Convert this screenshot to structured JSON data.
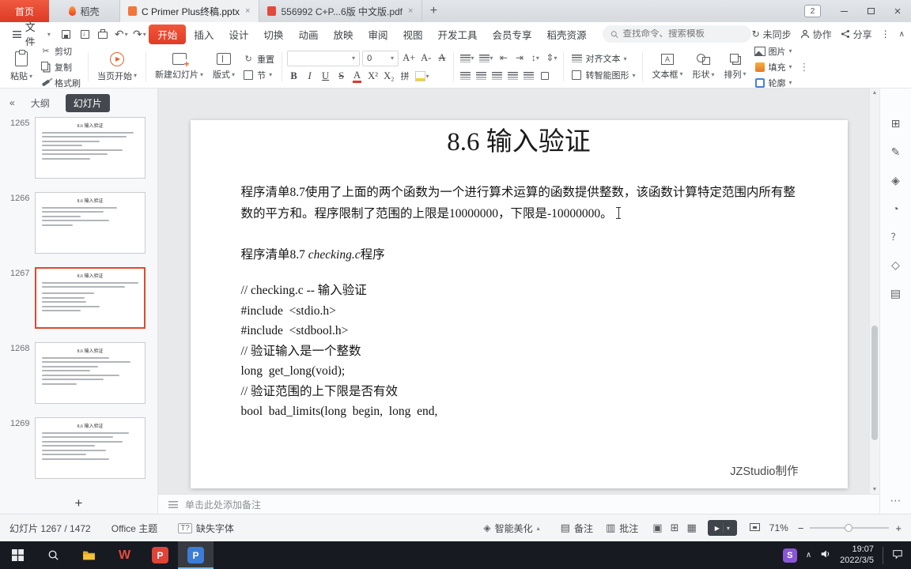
{
  "colors": {
    "accent": "#e5412e",
    "selection_border": "#e0492e",
    "taskbar_active_underline": "#76b9ed"
  },
  "titlebar": {
    "home": "首页",
    "docer": "稻壳",
    "badge": "2",
    "tabs": [
      {
        "label": "C Primer Plus终稿.pptx"
      },
      {
        "label": "556992 C+P...6版 中文版.pdf"
      }
    ]
  },
  "menubar": {
    "file": "文件",
    "tabs": [
      "开始",
      "插入",
      "设计",
      "切换",
      "动画",
      "放映",
      "审阅",
      "视图",
      "开发工具",
      "会员专享",
      "稻壳资源"
    ],
    "active_tab": "开始",
    "search_placeholder": "查找命令、搜索模板",
    "sync": "未同步",
    "collaborate": "协作",
    "share": "分享"
  },
  "ribbon": {
    "paste": "粘贴",
    "cut": "剪切",
    "copy": "复制",
    "painter": "格式刷",
    "play_current": "当页开始",
    "new_slide": "新建幻灯片",
    "layout": "版式",
    "reset": "重置",
    "section": "节",
    "font_name": "",
    "font_size": "0",
    "grow_font": "A+",
    "shrink_font": "A-",
    "clear_format": "A",
    "bold": "B",
    "italic": "I",
    "underline": "U",
    "strike": "S",
    "font_color": "A",
    "superscript": "X²",
    "subscript": "X₂",
    "pinyin": "拼",
    "align_text": "对齐文本",
    "smart_graphic": "转智能图形",
    "textbox": "文本框",
    "shapes": "形状",
    "arrange": "排列",
    "picture": "图片",
    "fill": "填充",
    "outline": "轮廓"
  },
  "sidebar": {
    "outline_tab": "大纲",
    "slides_tab": "幻灯片",
    "slides": [
      {
        "num": "1265",
        "title": "8.6 输入验证"
      },
      {
        "num": "1266",
        "title": "8.6 输入验证"
      },
      {
        "num": "1267",
        "title": "8.6 输入验证"
      },
      {
        "num": "1268",
        "title": "8.6 输入验证"
      },
      {
        "num": "1269",
        "title": "8.6 输入验证"
      }
    ]
  },
  "slide": {
    "title": "8.6 输入验证",
    "paragraph": "程序清单8.7使用了上面的两个函数为一个进行算术运算的函数提供整数，该函数计算特定范围内所有整数的平方和。程序限制了范围的上限是10000000，下限是-10000000。",
    "listing_pre": "程序清单8.7 ",
    "listing_file": "checking.c",
    "listing_post": "程序",
    "code": [
      "// checking.c -- 输入验证",
      "#include  <stdio.h>",
      "#include  <stdbool.h>",
      "// 验证输入是一个整数",
      "long  get_long(void);",
      "// 验证范围的上下限是否有效",
      "bool  bad_limits(long  begin,  long  end,"
    ],
    "credit": "JZStudio制作"
  },
  "notes": {
    "placeholder": "单击此处添加备注"
  },
  "statusbar": {
    "slide_info": "幻灯片 1267 / 1472",
    "theme": "Office 主题",
    "missing_font_icon": "T?",
    "missing_font": "缺失字体",
    "beautify": "智能美化",
    "notes_btn": "备注",
    "comments_btn": "批注",
    "zoom": "71%"
  },
  "taskbar": {
    "time": "19:07",
    "date": "2022/3/5",
    "apps": [
      {
        "letter": "W"
      },
      {
        "letter": "P"
      },
      {
        "letter": "P"
      }
    ],
    "tray_letter": "S"
  }
}
